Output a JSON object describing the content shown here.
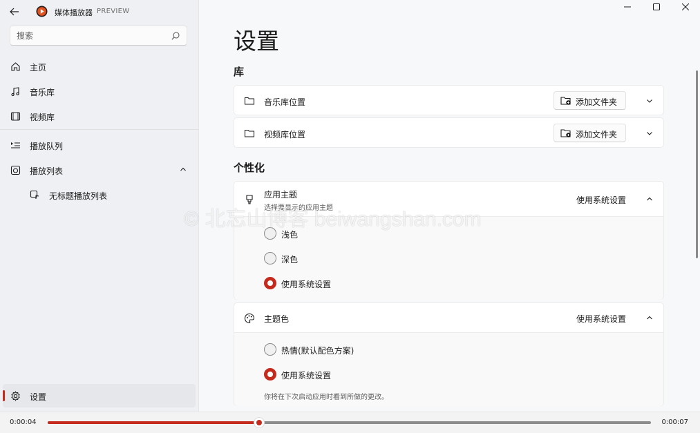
{
  "app": {
    "title": "媒体播放器",
    "badge": "PREVIEW",
    "accent_color": "#c42b1c"
  },
  "search": {
    "placeholder": "搜索"
  },
  "sidebar": {
    "items": [
      {
        "label": "主页",
        "icon": "home-icon"
      },
      {
        "label": "音乐库",
        "icon": "music-note-icon"
      },
      {
        "label": "视频库",
        "icon": "film-icon"
      },
      {
        "label": "播放队列",
        "icon": "queue-icon"
      },
      {
        "label": "播放列表",
        "icon": "playlist-icon",
        "expanded": true
      },
      {
        "label": "无标题播放列表",
        "icon": "playlist-item-icon"
      },
      {
        "label": "设置",
        "icon": "gear-icon",
        "selected": true
      }
    ]
  },
  "settings": {
    "title": "设置",
    "library": {
      "heading": "库",
      "music_label": "音乐库位置",
      "video_label": "视频库位置",
      "add_folder_label": "添加文件夹"
    },
    "personalization": {
      "heading": "个性化",
      "theme": {
        "label": "应用主题",
        "description": "选择要显示的应用主题",
        "value": "使用系统设置",
        "options": [
          "浅色",
          "深色",
          "使用系统设置"
        ],
        "selected_index": 2
      },
      "accent": {
        "label": "主题色",
        "value": "使用系统设置",
        "options": [
          "热情(默认配色方案)",
          "使用系统设置"
        ],
        "selected_index": 1,
        "note": "你将在下次启动应用时看到所做的更改。"
      }
    }
  },
  "player": {
    "current_time": "0:00:04",
    "total_time": "0:00:07",
    "progress": 0.35
  },
  "watermark": "© 北忘山博客 beiwangshan.com"
}
